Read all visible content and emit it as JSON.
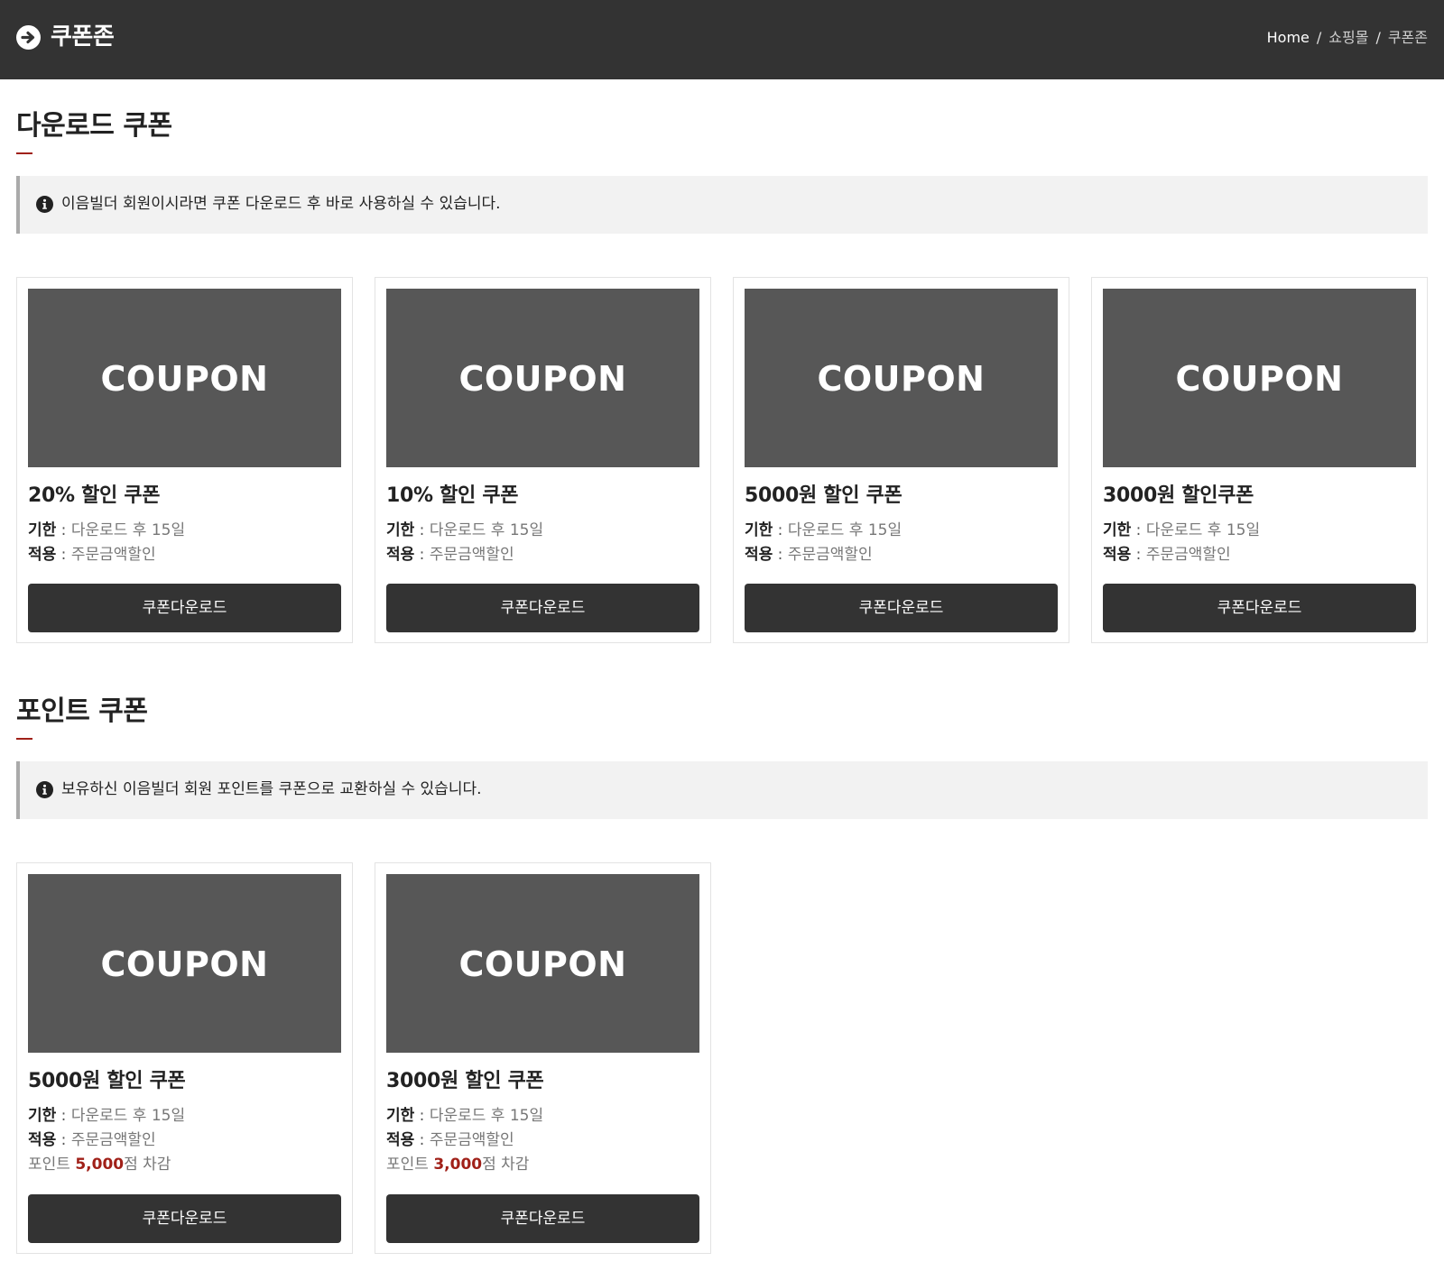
{
  "header": {
    "title": "쿠폰존",
    "breadcrumb": [
      "Home",
      "쇼핑몰",
      "쿠폰존"
    ],
    "separator": "/"
  },
  "download_section": {
    "title": "다운로드 쿠폰",
    "notice": "이음빌더 회원이시라면 쿠폰 다운로드 후 바로 사용하실 수 있습니다.",
    "cards": [
      {
        "image_label": "COUPON",
        "title": "20% 할인 쿠폰",
        "period_key": "기한",
        "period_value": "다운로드 후 15일",
        "apply_key": "적용",
        "apply_value": "주문금액할인",
        "button": "쿠폰다운로드"
      },
      {
        "image_label": "COUPON",
        "title": "10% 할인 쿠폰",
        "period_key": "기한",
        "period_value": "다운로드 후 15일",
        "apply_key": "적용",
        "apply_value": "주문금액할인",
        "button": "쿠폰다운로드"
      },
      {
        "image_label": "COUPON",
        "title": "5000원 할인 쿠폰",
        "period_key": "기한",
        "period_value": "다운로드 후 15일",
        "apply_key": "적용",
        "apply_value": "주문금액할인",
        "button": "쿠폰다운로드"
      },
      {
        "image_label": "COUPON",
        "title": "3000원 할인쿠폰",
        "period_key": "기한",
        "period_value": "다운로드 후 15일",
        "apply_key": "적용",
        "apply_value": "주문금액할인",
        "button": "쿠폰다운로드"
      }
    ]
  },
  "point_section": {
    "title": "포인트 쿠폰",
    "notice": "보유하신 이음빌더 회원 포인트를 쿠폰으로 교환하실 수 있습니다.",
    "cards": [
      {
        "image_label": "COUPON",
        "title": "5000원 할인 쿠폰",
        "period_key": "기한",
        "period_value": "다운로드 후 15일",
        "apply_key": "적용",
        "apply_value": "주문금액할인",
        "point_prefix": "포인트",
        "point_amount": "5,000",
        "point_suffix": "점 차감",
        "button": "쿠폰다운로드"
      },
      {
        "image_label": "COUPON",
        "title": "3000원 할인 쿠폰",
        "period_key": "기한",
        "period_value": "다운로드 후 15일",
        "apply_key": "적용",
        "apply_value": "주문금액할인",
        "point_prefix": "포인트",
        "point_amount": "3,000",
        "point_suffix": "점 차감",
        "button": "쿠폰다운로드"
      }
    ]
  },
  "colors": {
    "header_bg": "#333333",
    "accent_red": "#a02018",
    "button_bg": "#333333",
    "thumb_bg": "#575757",
    "notice_bg": "#f2f2f2"
  },
  "icons": {
    "header": "arrow-right-circle-icon",
    "notice": "info-circle-icon"
  }
}
